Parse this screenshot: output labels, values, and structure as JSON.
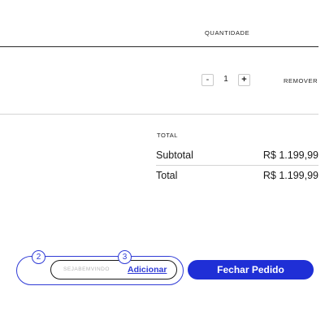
{
  "cart": {
    "quantity_header": "QUANTIDADE",
    "item": {
      "minus_label": "-",
      "quantity": "1",
      "plus_label": "+",
      "remove_label": "REMOVER"
    }
  },
  "totals": {
    "section_label": "TOTAL",
    "subtotal_label": "Subtotal",
    "subtotal_value": "R$ 1.199,99",
    "total_label": "Total",
    "total_value": "R$ 1.199,99"
  },
  "coupon": {
    "placeholder": "SEJABEMVINDO",
    "add_label": "Adicionar",
    "badge_left": "2",
    "badge_right": "3"
  },
  "checkout": {
    "button_label": "Fechar Pedido"
  },
  "colors": {
    "accent": "#1f2fd6",
    "outline_accent": "#2f3bd6"
  }
}
